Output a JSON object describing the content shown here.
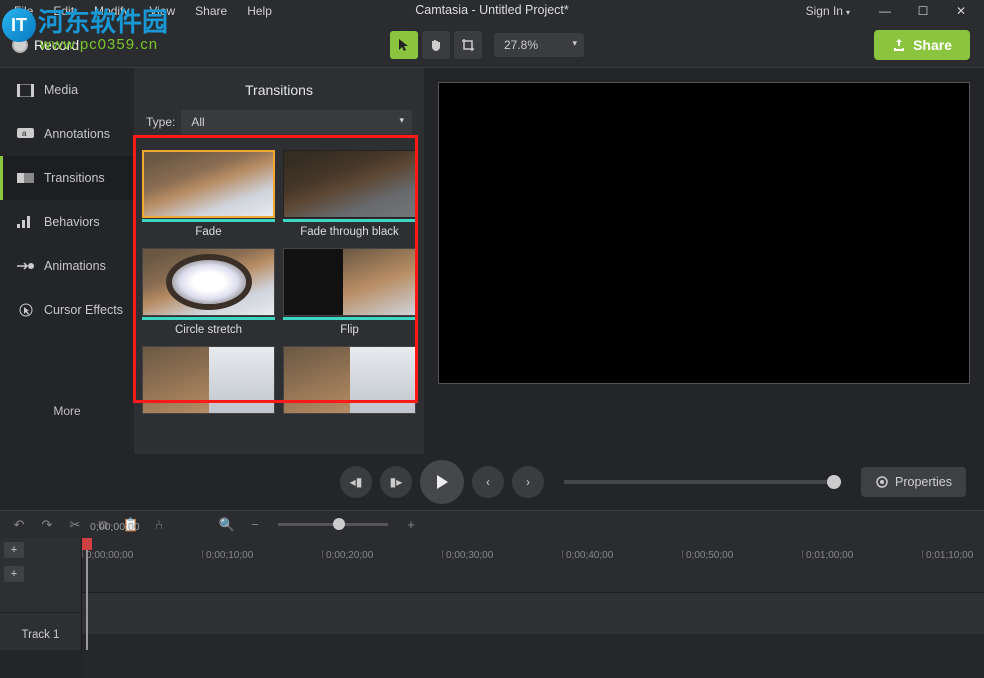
{
  "app": {
    "title": "Camtasia - Untitled Project*",
    "menu": {
      "file": "File",
      "edit": "Edit",
      "modify": "Modify",
      "view": "View",
      "share": "Share",
      "help": "Help"
    },
    "signin": "Sign In",
    "record": "Record",
    "share_btn": "Share",
    "zoom": "27.8%"
  },
  "watermark": {
    "cn_text": "河东软件园",
    "url": "www.pc0359.cn",
    "badge": "IT"
  },
  "sidebar": {
    "items": [
      {
        "label": "Media"
      },
      {
        "label": "Annotations"
      },
      {
        "label": "Transitions"
      },
      {
        "label": "Behaviors"
      },
      {
        "label": "Animations"
      },
      {
        "label": "Cursor Effects"
      }
    ],
    "more": "More"
  },
  "panel": {
    "title": "Transitions",
    "type_label": "Type:",
    "type_value": "All",
    "thumbs": {
      "fade": "Fade",
      "fade_black": "Fade through black",
      "circle_stretch": "Circle stretch",
      "flip": "Flip"
    }
  },
  "playback": {
    "properties": "Properties"
  },
  "timeline": {
    "current": "0;00;00;00",
    "ticks": [
      "0;00;00;00",
      "0;00;10;00",
      "0;00;20;00",
      "0;00;30;00",
      "0;00;40;00",
      "0;00;50;00",
      "0;01;00;00",
      "0;01;10;00"
    ],
    "track1": "Track 1"
  },
  "colors": {
    "accent": "#8bc53f",
    "teal": "#3dd6c3",
    "selection": "#f0a830",
    "redbox": "#ff1a1a"
  }
}
